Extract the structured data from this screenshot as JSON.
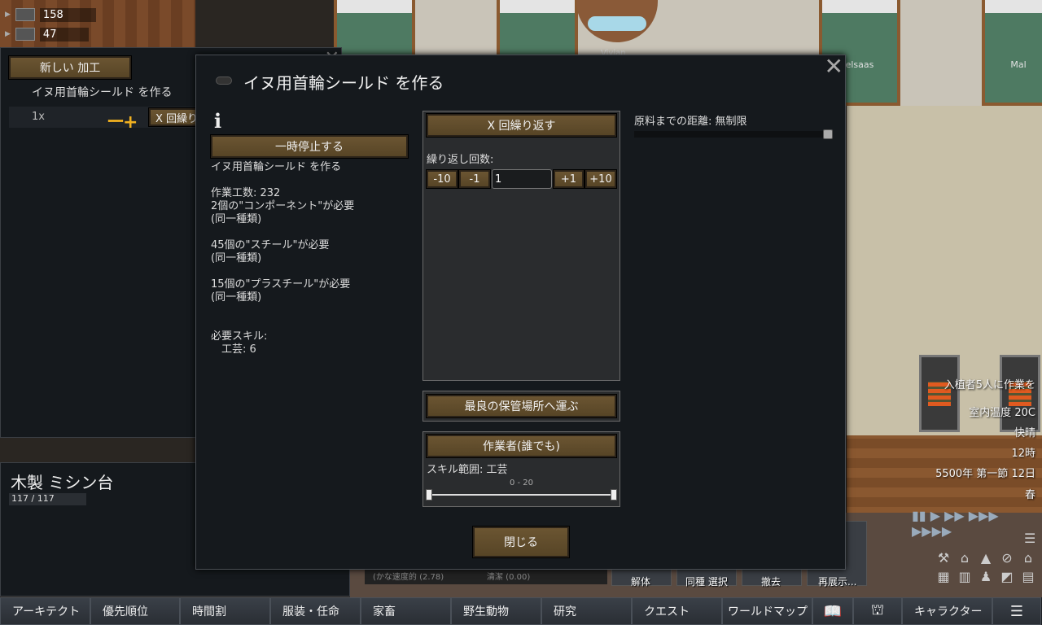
{
  "resources": [
    {
      "icon": "silver-icon",
      "value": "158"
    },
    {
      "icon": "steel-icon",
      "value": "47"
    }
  ],
  "world": {
    "pawn_label": "Vivian",
    "bed_labels": [
      "elsaas",
      "Mal"
    ]
  },
  "bills": {
    "new_bill_label": "新しい 加工",
    "bill_name": "イヌ用首輪シールド を作る",
    "bill_count": "1x",
    "bill_minus_plus": "ー+",
    "bill_repeat_label": "X 回繰り"
  },
  "inspect": {
    "name": "木製 ミシン台",
    "hp": "117 / 117"
  },
  "dialog": {
    "title": "イヌ用首輪シールド を作る",
    "info_icon": "i",
    "pause_label": "一時停止する",
    "description": [
      "イヌ用首輪シールド を作る",
      "",
      "作業工数: 232",
      "2個の\"コンポーネント\"が必要",
      "(同一種類)",
      "",
      "45個の\"スチール\"が必要",
      "(同一種類)",
      "",
      "15個の\"プラスチール\"が必要",
      "(同一種類)",
      "",
      "",
      "必要スキル:",
      "　工芸: 6"
    ],
    "repeat_mode_label": "X 回繰り返す",
    "repeat_count_label": "繰り返し回数:",
    "step_buttons": [
      "-10",
      "-1",
      "+1",
      "+10"
    ],
    "repeat_count_value": "1",
    "store_mode_label": "最良の保管場所へ運ぶ",
    "worker_label": "作業者(誰でも)",
    "skill_range_label": "スキル範囲: 工芸",
    "skill_range_value": "0 - 20",
    "distance_label": "原料までの距離: 無制限",
    "close_label": "閉じる"
  },
  "hud": {
    "alert": "入植者5人に作業を",
    "temperature": "室内温度 20C",
    "weather": "快晴",
    "time": "12時",
    "date": "5500年 第一節 12日",
    "season": "春",
    "speed_controls": "▮▮ ▶ ▶▶ ▶▶▶ ▶▶▶▶"
  },
  "architect": {
    "stat_left": "(かな速度的 (2.78)",
    "stat_right": "清潔 (0.00)",
    "buttons": [
      "解体",
      "同種 選択",
      "撤去",
      "再展示..."
    ]
  },
  "tabs": [
    "アーキテクト",
    "優先順位",
    "時間割",
    "服装・任命",
    "家畜",
    "野生動物",
    "研究",
    "クエスト",
    "ワールドマップ",
    "",
    "",
    "キャラクター",
    ""
  ],
  "tab_icons": [
    "book-icon",
    "factions-icon",
    "menu-icon"
  ]
}
